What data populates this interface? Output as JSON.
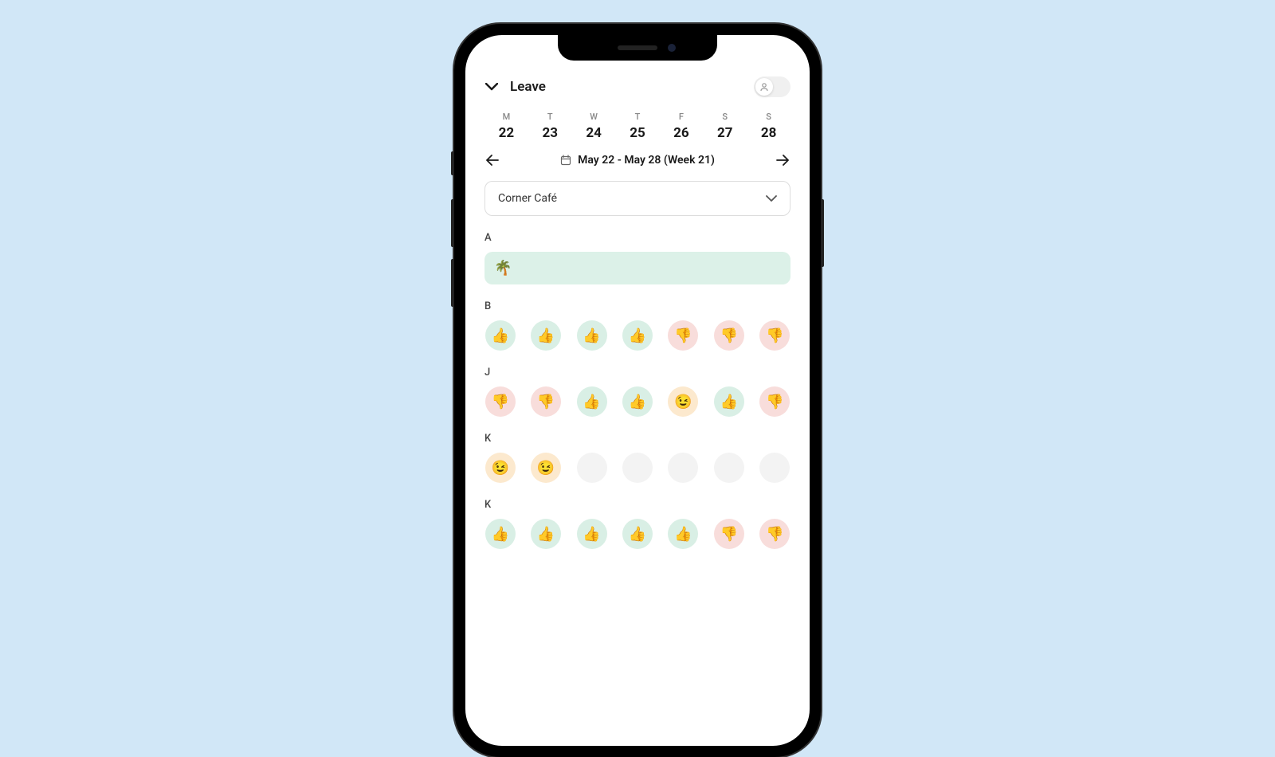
{
  "header": {
    "title": "Leave"
  },
  "week": {
    "days": [
      {
        "label": "M",
        "number": "22"
      },
      {
        "label": "T",
        "number": "23"
      },
      {
        "label": "W",
        "number": "24"
      },
      {
        "label": "T",
        "number": "25"
      },
      {
        "label": "F",
        "number": "26"
      },
      {
        "label": "S",
        "number": "27"
      },
      {
        "label": "S",
        "number": "28"
      }
    ],
    "range_label": "May 22 - May 28 (Week 21)"
  },
  "location": {
    "selected": "Corner Café"
  },
  "sections": [
    {
      "label": "A",
      "type": "leave",
      "icon": "🌴"
    },
    {
      "label": "B",
      "type": "status",
      "cells": [
        "up",
        "up",
        "up",
        "up",
        "down",
        "down",
        "down"
      ]
    },
    {
      "label": "J",
      "type": "status",
      "cells": [
        "down",
        "down",
        "up",
        "up",
        "maybe",
        "up",
        "down"
      ]
    },
    {
      "label": "K",
      "type": "status",
      "cells": [
        "maybe",
        "maybe",
        "empty",
        "empty",
        "empty",
        "empty",
        "empty"
      ]
    },
    {
      "label": "K",
      "type": "status",
      "cells": [
        "up",
        "up",
        "up",
        "up",
        "up",
        "down",
        "down"
      ]
    }
  ],
  "status_icons": {
    "up": "👍",
    "down": "👎",
    "maybe": "😉",
    "empty": ""
  }
}
